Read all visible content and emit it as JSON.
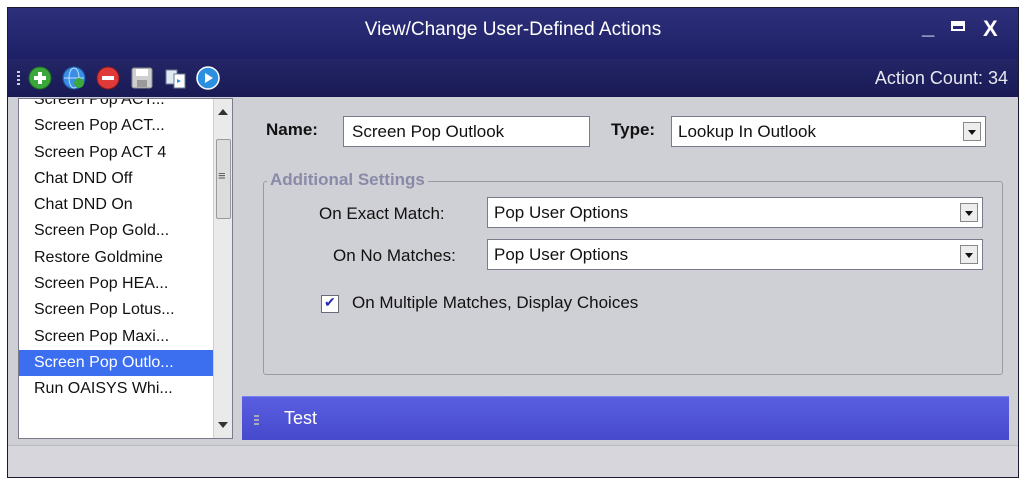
{
  "window": {
    "title": "View/Change User-Defined Actions"
  },
  "toolbar": {
    "buttons": [
      {
        "name": "add-icon",
        "color": "#3aa83a"
      },
      {
        "name": "edit-globe-icon",
        "color": "#3a8ee6"
      },
      {
        "name": "remove-icon",
        "color": "#e0393a"
      },
      {
        "name": "save-icon",
        "color": "#c9c9c9"
      },
      {
        "name": "copy-icon",
        "color": "#7aa0c8"
      },
      {
        "name": "play-icon",
        "color": "#2d8fe0"
      }
    ],
    "action_count": "Action Count: 34"
  },
  "actions_list": {
    "items": [
      "Screen Pop ACT...",
      "Screen Pop ACT...",
      "Screen Pop ACT 4",
      "Chat DND Off",
      "Chat DND On",
      "Screen Pop Gold...",
      "Restore Goldmine",
      "Screen Pop HEA...",
      "Screen Pop Lotus...",
      "Screen Pop Maxi...",
      "Screen Pop Outlo...",
      "Run OAISYS Whi..."
    ],
    "selected_index": 10
  },
  "form": {
    "name_label": "Name:",
    "name_value": "Screen Pop Outlook",
    "type_label": "Type:",
    "type_value": "Lookup In Outlook",
    "group_title": "Additional Settings",
    "exact_label": "On Exact Match:",
    "exact_value": "Pop User Options",
    "nomatch_label": "On No Matches:",
    "nomatch_value": "Pop User Options",
    "multi_label": "On Multiple Matches, Display Choices",
    "multi_checked": true
  },
  "test": {
    "label": "Test"
  },
  "colors": {
    "title_bg": "#1e2066",
    "selection": "#3b6ff0",
    "test_bar": "#4649cc"
  }
}
